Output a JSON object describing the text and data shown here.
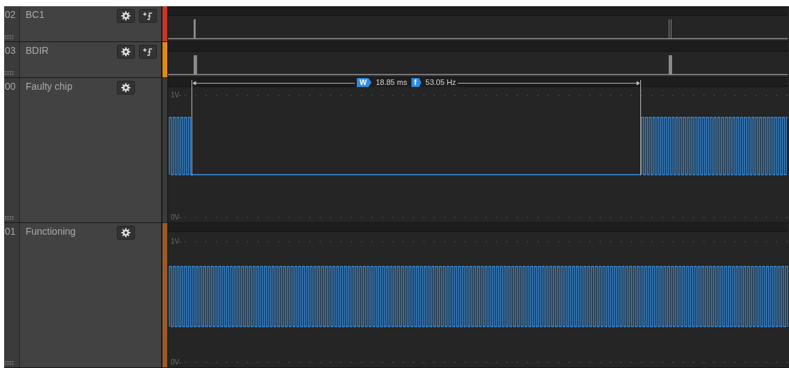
{
  "channels": [
    {
      "number": "02",
      "name": "BC1",
      "kind": "digital",
      "color": "#c8362a"
    },
    {
      "number": "03",
      "name": "BDIR",
      "kind": "digital",
      "color": "#e08a12"
    },
    {
      "number": "00",
      "name": "Faulty chip",
      "kind": "analog",
      "color": "#3a3a3a",
      "scale_top": "1V-",
      "scale_bottom": "0V-",
      "measurement": {
        "width_badge": "W",
        "width": "18.85 ms",
        "frequency_badge": "f",
        "frequency": "53.05 Hz"
      }
    },
    {
      "number": "01",
      "name": "Functioning",
      "kind": "analog",
      "color": "#9a5a2a",
      "scale_top": "1V-",
      "scale_bottom": "0V-"
    }
  ]
}
